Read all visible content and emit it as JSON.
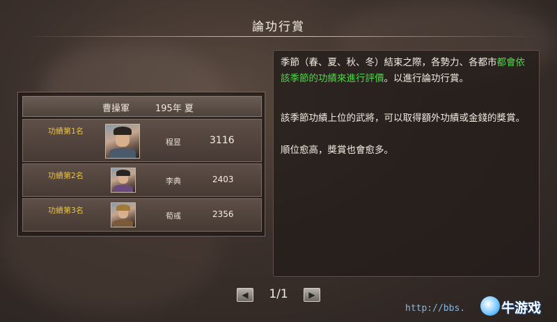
{
  "window": {
    "title": "論功行賞"
  },
  "ranking": {
    "faction": "曹操軍",
    "date": "195年 夏",
    "rows": [
      {
        "rank_label": "功績第1名",
        "general": "程昱",
        "score": "3116"
      },
      {
        "rank_label": "功績第2名",
        "general": "李典",
        "score": "2403"
      },
      {
        "rank_label": "功績第3名",
        "general": "荀彧",
        "score": "2356"
      }
    ]
  },
  "description": {
    "p1_a": "季節（春、夏、秋、冬）結束之際，各勢力、各都市",
    "p1_highlight": "都會依該季節的功績來進行評價",
    "p1_b": "。以進行論功行賞。",
    "p2": "該季節功績上位的武將，可以取得額外功績或金錢的獎賞。",
    "p3": "順位愈高，獎賞也會愈多。"
  },
  "pager": {
    "page": "1/1",
    "prev_icon": "chevron-left-icon",
    "next_icon": "chevron-right-icon"
  },
  "watermark": {
    "url": "http://bbs.",
    "logo_text": "牛游戏"
  },
  "colors": {
    "highlight": "#4fd84a",
    "rank_label": "#e8c24a"
  }
}
